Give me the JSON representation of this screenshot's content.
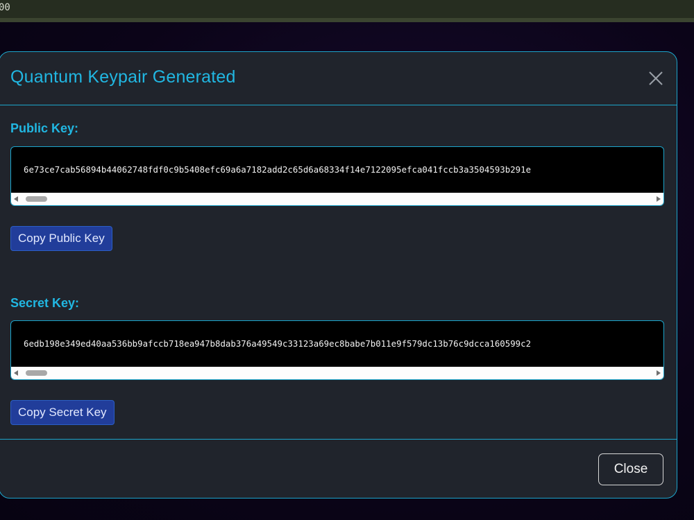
{
  "topbar": {
    "text": "00"
  },
  "modal": {
    "title": "Quantum Keypair Generated",
    "public": {
      "label": "Public Key:",
      "value": "6e73ce7cab56894b44062748fdf0c9b5408efc69a6a7182add2c65d6a68334f14e7122095efca041fccb3a3504593b291e",
      "copy_label": "Copy Public Key"
    },
    "secret": {
      "label": "Secret Key:",
      "value": "6edb198e349ed40aa536bb9afccb718ea947b8dab376a49549c33123a69ec8babe7b011e9f579dc13b76c9dcca160599c2",
      "copy_label": "Copy Secret Key"
    },
    "close_label": "Close"
  },
  "colors": {
    "accent": "#21b7e2",
    "modal_bg": "#20242c",
    "button_blue": "#213d9a"
  },
  "icons": {
    "close": "close-icon"
  }
}
